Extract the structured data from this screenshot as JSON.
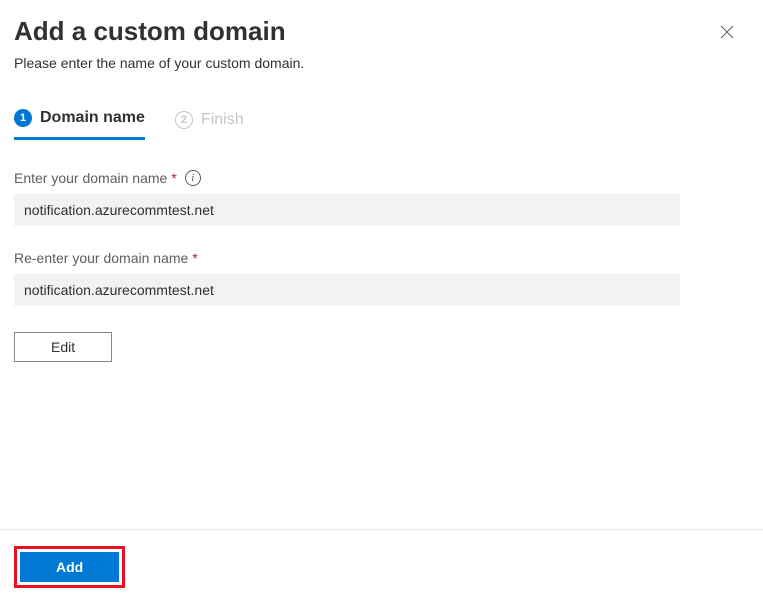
{
  "header": {
    "title": "Add a custom domain",
    "subtitle": "Please enter the name of your custom domain."
  },
  "tabs": {
    "step1": {
      "number": "1",
      "label": "Domain name"
    },
    "step2": {
      "number": "2",
      "label": "Finish"
    }
  },
  "form": {
    "domain_label": "Enter your domain name",
    "domain_value": "notification.azurecommtest.net",
    "redomain_label": "Re-enter your domain name",
    "redomain_value": "notification.azurecommtest.net",
    "edit_label": "Edit"
  },
  "footer": {
    "add_label": "Add"
  },
  "symbols": {
    "required": "*",
    "info": "i"
  }
}
